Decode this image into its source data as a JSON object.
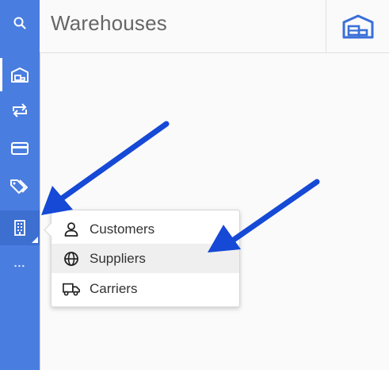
{
  "page": {
    "title": "Warehouses"
  },
  "sidebar": {
    "items": [
      {
        "icon": "search-icon"
      },
      {
        "icon": "warehouse-icon",
        "active": true
      },
      {
        "icon": "transfer-icon"
      },
      {
        "icon": "credit-card-icon"
      },
      {
        "icon": "tags-icon"
      },
      {
        "icon": "building-icon"
      },
      {
        "icon": "more-icon",
        "label": "..."
      }
    ]
  },
  "header": {
    "right_icon": "warehouse-icon"
  },
  "popup_menu": {
    "items": [
      {
        "label": "Customers",
        "icon": "person-icon"
      },
      {
        "label": "Suppliers",
        "icon": "globe-icon",
        "highlighted": true
      },
      {
        "label": "Carriers",
        "icon": "truck-icon"
      }
    ]
  },
  "colors": {
    "sidebar": "#4a7de0",
    "arrow": "#1549d6",
    "accent_icon": "#3a6fd8"
  }
}
